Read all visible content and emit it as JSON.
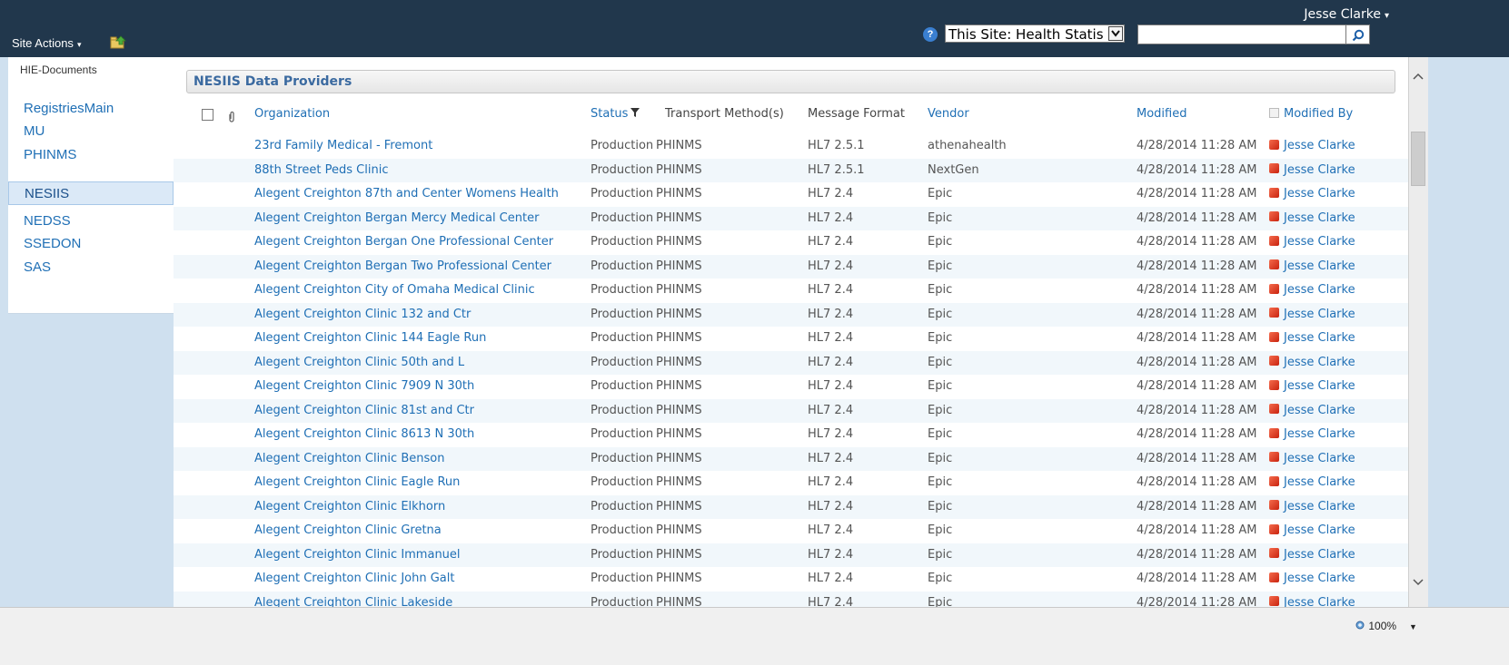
{
  "header": {
    "user_name": "Jesse Clarke",
    "site_actions_label": "Site Actions",
    "search_scope": "This Site: Health Statist",
    "search_value": ""
  },
  "left_nav": {
    "header": "HIE-Documents",
    "items": [
      {
        "label": "RegistriesMain",
        "selected": false
      },
      {
        "label": "MU",
        "selected": false
      },
      {
        "label": "PHINMS",
        "selected": false
      },
      {
        "label": "NESIIS",
        "selected": true
      },
      {
        "label": "NEDSS",
        "selected": false
      },
      {
        "label": "SSEDON",
        "selected": false
      },
      {
        "label": "SAS",
        "selected": false
      }
    ]
  },
  "list": {
    "title": "NESIIS Data Providers",
    "columns": {
      "organization": "Organization",
      "status": "Status",
      "transport": "Transport Method(s)",
      "format": "Message Format",
      "vendor": "Vendor",
      "modified": "Modified",
      "modified_by": "Modified By"
    },
    "rows": [
      {
        "org": "23rd Family Medical - Fremont",
        "status": "Production",
        "transport": "PHINMS",
        "format": "HL7 2.5.1",
        "vendor": "athenahealth",
        "modified": "4/28/2014 11:28 AM",
        "modified_by": "Jesse Clarke"
      },
      {
        "org": "88th Street Peds Clinic",
        "status": "Production",
        "transport": "PHINMS",
        "format": "HL7 2.5.1",
        "vendor": "NextGen",
        "modified": "4/28/2014 11:28 AM",
        "modified_by": "Jesse Clarke"
      },
      {
        "org": "Alegent Creighton 87th and Center Womens Health",
        "status": "Production",
        "transport": "PHINMS",
        "format": "HL7 2.4",
        "vendor": "Epic",
        "modified": "4/28/2014 11:28 AM",
        "modified_by": "Jesse Clarke"
      },
      {
        "org": "Alegent Creighton Bergan Mercy Medical Center",
        "status": "Production",
        "transport": "PHINMS",
        "format": "HL7 2.4",
        "vendor": "Epic",
        "modified": "4/28/2014 11:28 AM",
        "modified_by": "Jesse Clarke"
      },
      {
        "org": "Alegent Creighton Bergan One Professional Center",
        "status": "Production",
        "transport": "PHINMS",
        "format": "HL7 2.4",
        "vendor": "Epic",
        "modified": "4/28/2014 11:28 AM",
        "modified_by": "Jesse Clarke"
      },
      {
        "org": "Alegent Creighton Bergan Two Professional Center",
        "status": "Production",
        "transport": "PHINMS",
        "format": "HL7 2.4",
        "vendor": "Epic",
        "modified": "4/28/2014 11:28 AM",
        "modified_by": "Jesse Clarke"
      },
      {
        "org": "Alegent Creighton City of Omaha Medical Clinic",
        "status": "Production",
        "transport": "PHINMS",
        "format": "HL7 2.4",
        "vendor": "Epic",
        "modified": "4/28/2014 11:28 AM",
        "modified_by": "Jesse Clarke"
      },
      {
        "org": "Alegent Creighton Clinic 132 and Ctr",
        "status": "Production",
        "transport": "PHINMS",
        "format": "HL7 2.4",
        "vendor": "Epic",
        "modified": "4/28/2014 11:28 AM",
        "modified_by": "Jesse Clarke"
      },
      {
        "org": "Alegent Creighton Clinic 144 Eagle Run",
        "status": "Production",
        "transport": "PHINMS",
        "format": "HL7 2.4",
        "vendor": "Epic",
        "modified": "4/28/2014 11:28 AM",
        "modified_by": "Jesse Clarke"
      },
      {
        "org": "Alegent Creighton Clinic 50th and L",
        "status": "Production",
        "transport": "PHINMS",
        "format": "HL7 2.4",
        "vendor": "Epic",
        "modified": "4/28/2014 11:28 AM",
        "modified_by": "Jesse Clarke"
      },
      {
        "org": "Alegent Creighton Clinic 7909 N 30th",
        "status": "Production",
        "transport": "PHINMS",
        "format": "HL7 2.4",
        "vendor": "Epic",
        "modified": "4/28/2014 11:28 AM",
        "modified_by": "Jesse Clarke"
      },
      {
        "org": "Alegent Creighton Clinic 81st and Ctr",
        "status": "Production",
        "transport": "PHINMS",
        "format": "HL7 2.4",
        "vendor": "Epic",
        "modified": "4/28/2014 11:28 AM",
        "modified_by": "Jesse Clarke"
      },
      {
        "org": "Alegent Creighton Clinic 8613 N 30th",
        "status": "Production",
        "transport": "PHINMS",
        "format": "HL7 2.4",
        "vendor": "Epic",
        "modified": "4/28/2014 11:28 AM",
        "modified_by": "Jesse Clarke"
      },
      {
        "org": "Alegent Creighton Clinic Benson",
        "status": "Production",
        "transport": "PHINMS",
        "format": "HL7 2.4",
        "vendor": "Epic",
        "modified": "4/28/2014 11:28 AM",
        "modified_by": "Jesse Clarke"
      },
      {
        "org": "Alegent Creighton Clinic Eagle Run",
        "status": "Production",
        "transport": "PHINMS",
        "format": "HL7 2.4",
        "vendor": "Epic",
        "modified": "4/28/2014 11:28 AM",
        "modified_by": "Jesse Clarke"
      },
      {
        "org": "Alegent Creighton Clinic Elkhorn",
        "status": "Production",
        "transport": "PHINMS",
        "format": "HL7 2.4",
        "vendor": "Epic",
        "modified": "4/28/2014 11:28 AM",
        "modified_by": "Jesse Clarke"
      },
      {
        "org": "Alegent Creighton Clinic Gretna",
        "status": "Production",
        "transport": "PHINMS",
        "format": "HL7 2.4",
        "vendor": "Epic",
        "modified": "4/28/2014 11:28 AM",
        "modified_by": "Jesse Clarke"
      },
      {
        "org": "Alegent Creighton Clinic Immanuel",
        "status": "Production",
        "transport": "PHINMS",
        "format": "HL7 2.4",
        "vendor": "Epic",
        "modified": "4/28/2014 11:28 AM",
        "modified_by": "Jesse Clarke"
      },
      {
        "org": "Alegent Creighton Clinic John Galt",
        "status": "Production",
        "transport": "PHINMS",
        "format": "HL7 2.4",
        "vendor": "Epic",
        "modified": "4/28/2014 11:28 AM",
        "modified_by": "Jesse Clarke"
      },
      {
        "org": "Alegent Creighton Clinic Lakeside",
        "status": "Production",
        "transport": "PHINMS",
        "format": "HL7 2.4",
        "vendor": "Epic",
        "modified": "4/28/2014 11:28 AM",
        "modified_by": "Jesse Clarke"
      }
    ]
  },
  "statusbar": {
    "zoom": "100%"
  },
  "icons": {
    "help": "help-icon",
    "search": "search-icon",
    "attachment": "paperclip-icon",
    "filter": "filter-icon",
    "presence": "presence-icon",
    "navigate_up": "navigate-up-icon",
    "zoom": "zoom-icon"
  },
  "colors": {
    "top_bar": "#21374c",
    "link": "#1f6fb5",
    "title": "#3b6aa0",
    "alt_row": "#f1f7fb",
    "presence": "#d9381e"
  }
}
